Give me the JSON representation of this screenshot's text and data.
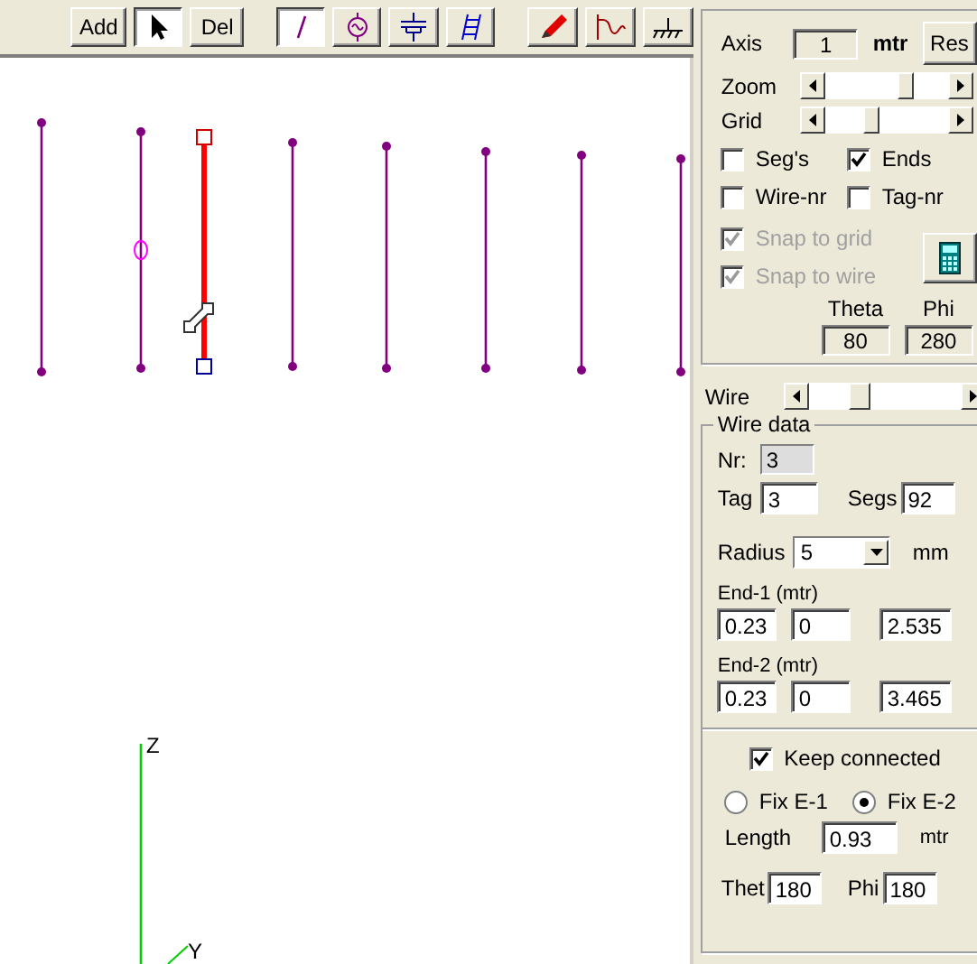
{
  "toolbar": [
    {
      "kind": "text",
      "label": "Add",
      "selected": false
    },
    {
      "kind": "pointer",
      "selected": true
    },
    {
      "kind": "text",
      "label": "Del",
      "selected": false
    },
    {
      "kind": "wire",
      "selected": true
    },
    {
      "kind": "source",
      "selected": false
    },
    {
      "kind": "load",
      "selected": false
    },
    {
      "kind": "ladder",
      "selected": false
    },
    {
      "kind": "pencil",
      "selected": false
    },
    {
      "kind": "pattern",
      "selected": false
    },
    {
      "kind": "ground",
      "selected": false
    }
  ],
  "wires": [
    {
      "selected": false,
      "source": false
    },
    {
      "selected": false,
      "source": true
    },
    {
      "selected": true,
      "source": false
    },
    {
      "selected": false,
      "source": false
    },
    {
      "selected": false,
      "source": false
    },
    {
      "selected": false,
      "source": false
    },
    {
      "selected": false,
      "source": false
    },
    {
      "selected": false,
      "source": false
    }
  ],
  "axes": [
    {
      "label": "Z"
    },
    {
      "label": "Y"
    }
  ],
  "view": {
    "axis_label": "Axis",
    "axis_value": "1",
    "axis_unit": "mtr",
    "reset": "Res",
    "zoom": {
      "label": "Zoom",
      "level": 0.68
    },
    "grid": {
      "label": "Grid",
      "level": 0.35
    },
    "options": [
      {
        "label": "Seg's",
        "checked": false,
        "disabled": false
      },
      {
        "label": "Ends",
        "checked": true,
        "disabled": false
      },
      {
        "label": "Wire-nr",
        "checked": false,
        "disabled": false
      },
      {
        "label": "Tag-nr",
        "checked": false,
        "disabled": false
      }
    ],
    "snap": [
      {
        "label": "Snap to grid",
        "checked": true,
        "disabled": true
      },
      {
        "label": "Snap to wire",
        "checked": true,
        "disabled": true
      }
    ],
    "theta_label": "Theta",
    "phi_label": "Phi",
    "theta": "80",
    "phi": "280"
  },
  "wire_slider": {
    "label": "Wire",
    "level": 0.3
  },
  "wire_data": {
    "title": "Wire data",
    "nr_label": "Nr:",
    "nr": "3",
    "tag_label": "Tag",
    "tag": "3",
    "segs_label": "Segs",
    "segs": "92",
    "radius_label": "Radius",
    "radius": "5",
    "radius_unit": "mm",
    "end1_label": "End-1 (mtr)",
    "end1": [
      "0.23",
      "0",
      "2.535"
    ],
    "end2_label": "End-2 (mtr)",
    "end2": [
      "0.23",
      "0",
      "3.465"
    ],
    "keep_connected": {
      "label": "Keep connected",
      "checked": true
    },
    "fix": [
      {
        "label": "Fix E-1",
        "selected": false
      },
      {
        "label": "Fix E-2",
        "selected": true
      }
    ],
    "length_label": "Length",
    "length": "0.93",
    "length_unit": "mtr",
    "theta_label": "Thet",
    "theta": "180",
    "phi_label": "Phi",
    "phi": "180"
  }
}
